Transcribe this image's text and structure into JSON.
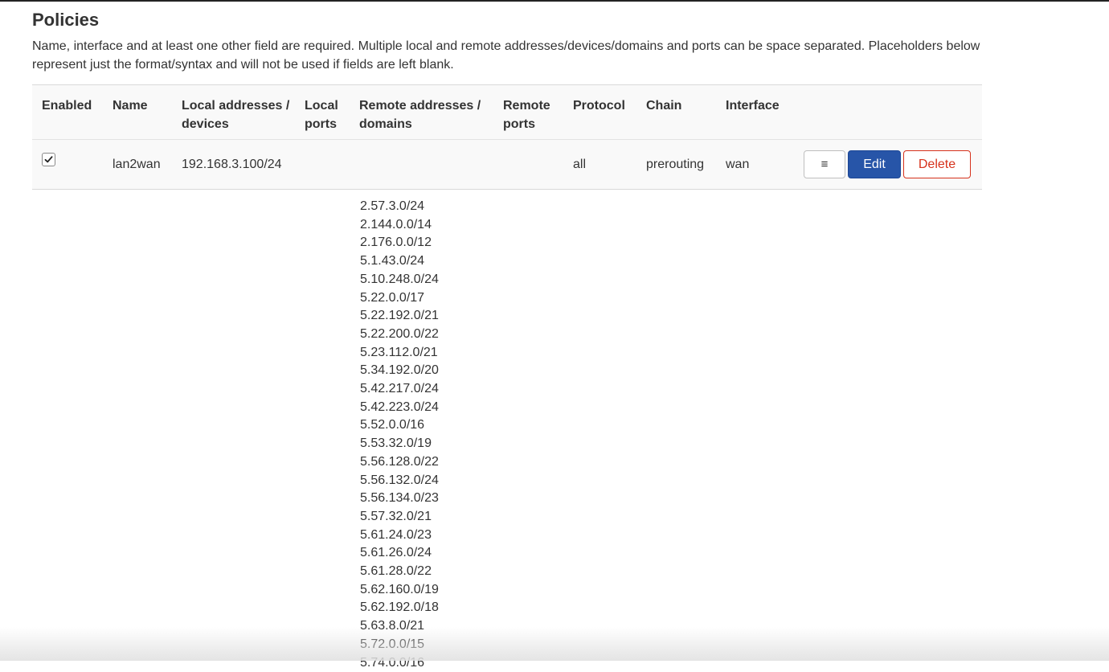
{
  "section": {
    "title": "Policies",
    "description": "Name, interface and at least one other field are required. Multiple local and remote addresses/devices/domains and ports can be space separated. Placeholders below represent just the format/syntax and will not be used if fields are left blank."
  },
  "table": {
    "headers": {
      "enabled": "Enabled",
      "name": "Name",
      "local_addresses": "Local addresses / devices",
      "local_ports": "Local ports",
      "remote_addresses": "Remote addresses / domains",
      "remote_ports": "Remote ports",
      "protocol": "Protocol",
      "chain": "Chain",
      "interface": "Interface"
    },
    "rows": [
      {
        "enabled": true,
        "name": "lan2wan",
        "local_addresses": "192.168.3.100/24",
        "local_ports": "",
        "remote_addresses": "",
        "remote_ports": "",
        "protocol": "all",
        "chain": "prerouting",
        "interface": "wan",
        "menu_label": "≡",
        "edit_label": "Edit",
        "delete_label": "Delete"
      }
    ]
  },
  "remote_address_list": [
    "2.57.3.0/24",
    "2.144.0.0/14",
    "2.176.0.0/12",
    "5.1.43.0/24",
    "5.10.248.0/24",
    "5.22.0.0/17",
    "5.22.192.0/21",
    "5.22.200.0/22",
    "5.23.112.0/21",
    "5.34.192.0/20",
    "5.42.217.0/24",
    "5.42.223.0/24",
    "5.52.0.0/16",
    "5.53.32.0/19",
    "5.56.128.0/22",
    "5.56.132.0/24",
    "5.56.134.0/23",
    "5.57.32.0/21",
    "5.61.24.0/23",
    "5.61.26.0/24",
    "5.61.28.0/22",
    "5.62.160.0/19",
    "5.62.192.0/18",
    "5.63.8.0/21",
    "5.72.0.0/15",
    "5.74.0.0/16"
  ],
  "colors": {
    "edit_button": "#2755a8",
    "delete_button": "#d6321c",
    "header_bg": "#f9f9f9"
  },
  "icons": {
    "checkbox": "checkmark-icon",
    "menu": "hamburger-menu-icon"
  }
}
